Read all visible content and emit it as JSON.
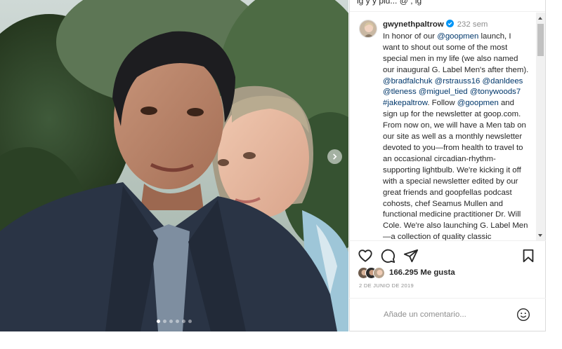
{
  "top_strip": {
    "text": "ig y y plu... @ , ig"
  },
  "post": {
    "username": "gwynethpaltrow",
    "time_ago": "232 sem",
    "caption_parts": [
      {
        "t": "In honor of our ",
        "link": false
      },
      {
        "t": "@goopmen",
        "link": true
      },
      {
        "t": " launch, I want to shout out some of the most special men in my life (we also named our inaugural G. Label Men's after them). ",
        "link": false
      },
      {
        "t": "@bradfalchuk",
        "link": true
      },
      {
        "t": " ",
        "link": false
      },
      {
        "t": "@rstrauss16",
        "link": true
      },
      {
        "t": " ",
        "link": false
      },
      {
        "t": "@danldees",
        "link": true
      },
      {
        "t": " ",
        "link": false
      },
      {
        "t": "@tleness",
        "link": true
      },
      {
        "t": " ",
        "link": false
      },
      {
        "t": "@miguel_tied",
        "link": true
      },
      {
        "t": " ",
        "link": false
      },
      {
        "t": "@tonywoods7",
        "link": true
      },
      {
        "t": " ",
        "link": false
      },
      {
        "t": "#jakepaltrow",
        "link": true
      },
      {
        "t": ". Follow ",
        "link": false
      },
      {
        "t": "@goopmen",
        "link": true
      },
      {
        "t": " and sign up for the newsletter at goop.com. From now on, we will have a Men tab on our site as well as a monthly newsletter devoted to you—from health to travel to an occasional circadian-rhythm-supporting lightbulb. We're kicking it off with a special newsletter edited by our great friends and goopfellas podcast cohosts, chef Seamus Mullen and functional medicine practitioner Dr. Will Cole. We're also launching G. Label Men—a collection of quality classic",
        "link": false
      }
    ],
    "likes_text": "166.295 Me gusta",
    "date": "2 DE JUNIO DE 2019",
    "comment_placeholder": "Añade un comentario...",
    "carousel": {
      "slide_count": 6,
      "active_index": 0
    }
  },
  "icons": {
    "like": "heart-icon",
    "comment": "comment-bubble-icon",
    "share": "paper-plane-icon",
    "save": "bookmark-icon",
    "emoji": "smiley-icon",
    "next": "chevron-right-icon",
    "verified": "verified-badge-icon"
  },
  "colors": {
    "link": "#00376b",
    "verified": "#0095f6",
    "muted": "#8e8e8e",
    "text": "#262626"
  }
}
